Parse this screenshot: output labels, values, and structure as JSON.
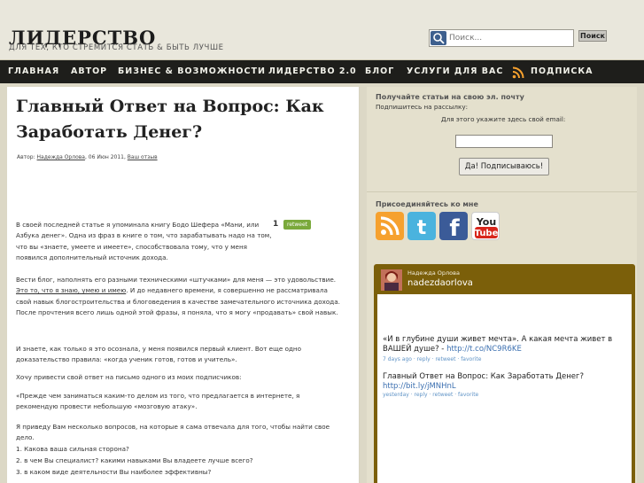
{
  "header": {
    "title": "ЛИДЕРСТВО",
    "tagline": "ДЛЯ ТЕХ, КТО СТРЕМИТСЯ СТАТЬ & БЫТЬ ЛУЧШЕ",
    "search_placeholder": "Поиск...",
    "search_button": "Поиск"
  },
  "nav": {
    "items": [
      "ГЛАВНАЯ",
      "АВТОР",
      "БИЗНЕС & ВОЗМОЖНОСТИ",
      "ЛИДЕРСТВО 2.0",
      "БЛОГ",
      "УСЛУГИ ДЛЯ ВАС",
      "ПОДПИСКА"
    ]
  },
  "post": {
    "title": "Главный Ответ на Вопрос: Как Заработать Денег?",
    "meta_prefix": "Автор: ",
    "meta_author": "Надежда Орлова",
    "meta_date": ", 06 Июн 2011, ",
    "meta_comments": "Ваш отзыв",
    "retweet_count": "1",
    "retweet_label": "retweet",
    "p1": "В своей последней статье я упоминала книгу Бодо Шефера «Мани, или Азбука денег». Одна из фраз в книге о том, что зарабатывать надо на том, что вы «знаете, умеете и имеете», способствовала тому, что у меня появился дополнительный источник дохода.",
    "p2_a": "Вести блог, наполнять его разными техническими «штучками» для меня — это удовольствие. ",
    "p2_link": "Это то, что я знаю, умею и имею",
    "p2_b": ". И до недавнего времени, я совершенно не рассматривала свой навык блогостроительства и блоговедения в качестве замечательного источника дохода. После прочтения всего лишь одной этой фразы, я поняла, что я могу «продавать» свой навык.",
    "p3": "И знаете, как только я это осознала, у меня появился первый клиент. Вот еще одно доказательство правила: «когда ученик готов, готов и учитель».",
    "p4": "Хочу привести свой ответ на письмо одного из моих подписчиков:",
    "p5": "«Прежде чем заниматься каким-то делом из того, что предлагается в интернете, я рекомендую провести небольшую «мозговую атаку».",
    "p6": "Я приведу Вам несколько вопросов, на которые я сама отвечала для того, чтобы найти свое дело.",
    "q1": "1. Какова ваша сильная сторона?",
    "q2": "2. в чем Вы специалист? какими навыками Вы владеете лучше всего?",
    "q3": "3. в каком виде деятельности Вы наиболее эффективны?"
  },
  "sidebar": {
    "subscribe_heading": "Получайте статьи на свою эл. почту",
    "subscribe_sub": "Подпишитесь на рассылку:",
    "email_label": "Для этого укажите здесь свой email:",
    "email_value": "",
    "subscribe_button": "Да! Подписываюсь!",
    "join_heading": "Присоединяйтесь ко мне",
    "social": [
      "rss-icon",
      "twitter-icon",
      "facebook-icon",
      "youtube-icon"
    ]
  },
  "twitter": {
    "name": "Надежда Орлова",
    "username": "nadezdaorlova",
    "tweets": [
      {
        "text": "«И в глубине души живет мечта». А какая мечта живет в ВАШЕЙ душе? - ",
        "link": "http://t.co/NC9R6KE",
        "time": "7 days ago",
        "actions": " · reply · retweet · favorite"
      },
      {
        "text": "Главный Ответ на Вопрос: Как Заработать Денег? ",
        "link": "http://bit.ly/jMNHnL",
        "time": "yesterday",
        "actions": " · reply · retweet · favorite"
      }
    ]
  },
  "colors": {
    "nav_bg": "#1e1e1b",
    "header_bg": "#e9e7dc",
    "sidebar_bg": "#e4e0cd",
    "twitter_widget": "#7b5f0a",
    "link_blue": "#3b6fb0",
    "rss_orange": "#f6a12e"
  }
}
